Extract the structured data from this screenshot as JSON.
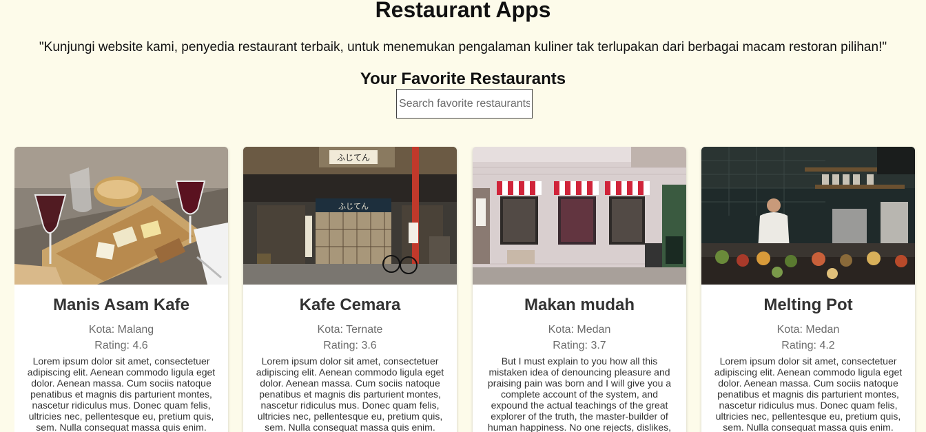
{
  "header": {
    "title": "Restaurant Apps",
    "tagline": "\"Kunjungi website kami, penyedia restaurant terbaik, untuk menemukan pengalaman kuliner tak terlupakan dari berbagai macam restoran pilihan!\""
  },
  "favorites": {
    "title": "Your Favorite Restaurants",
    "search_placeholder": "Search favorite restaurants",
    "search_value": ""
  },
  "restaurants": [
    {
      "name": "Manis Asam Kafe",
      "city": "Kota: Malang",
      "rating": "Rating: 4.6",
      "description": "Lorem ipsum dolor sit amet, consectetuer adipiscing elit. Aenean commodo ligula eget dolor. Aenean massa. Cum sociis natoque penatibus et magnis dis parturient montes, nascetur ridiculus mus. Donec quam felis, ultricies nec, pellentesque eu, pretium quis, sem. Nulla consequat massa quis enim.",
      "image_icon": "wine-cheese-photo"
    },
    {
      "name": "Kafe Cemara",
      "city": "Kota: Ternate",
      "rating": "Rating: 3.6",
      "description": "Lorem ipsum dolor sit amet, consectetuer adipiscing elit. Aenean commodo ligula eget dolor. Aenean massa. Cum sociis natoque penatibus et magnis dis parturient montes, nascetur ridiculus mus. Donec quam felis, ultricies nec, pellentesque eu, pretium quis, sem. Nulla consequat massa quis enim.",
      "image_icon": "japanese-storefront-photo",
      "image_sign": "ふじてん"
    },
    {
      "name": "Makan mudah",
      "city": "Kota: Medan",
      "rating": "Rating: 3.7",
      "description": "But I must explain to you how all this mistaken idea of denouncing pleasure and praising pain was born and I will give you a complete account of the system, and expound the actual teachings of the great explorer of the truth, the master-builder of human happiness. No one rejects, dislikes,",
      "image_icon": "striped-awning-cafe-photo"
    },
    {
      "name": "Melting Pot",
      "city": "Kota: Medan",
      "rating": "Rating: 4.2",
      "description": "Lorem ipsum dolor sit amet, consectetuer adipiscing elit. Aenean commodo ligula eget dolor. Aenean massa. Cum sociis natoque penatibus et magnis dis parturient montes, nascetur ridiculus mus. Donec quam felis, ultricies nec, pellentesque eu, pretium quis, sem. Nulla consequat massa quis enim.",
      "image_icon": "open-kitchen-chef-photo"
    }
  ],
  "colors": {
    "page_background": "#fdfbea",
    "card_background": "#ffffff",
    "muted_text": "#6c6c6c"
  }
}
